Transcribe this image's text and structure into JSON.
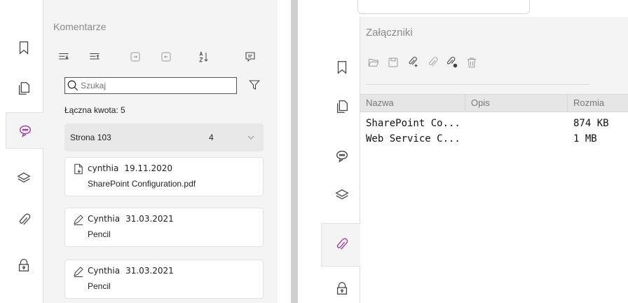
{
  "left_panel": {
    "title": "Komentarze",
    "search_placeholder": "Szukaj",
    "total_label": "Łączna kwota: 5",
    "group": {
      "label": "Strona 103",
      "count": "4"
    },
    "comments": [
      {
        "author": "cynthia",
        "date": "19.11.2020",
        "text": "SharePoint Configuration.pdf",
        "icon": "file-attachment-icon"
      },
      {
        "author": "Cynthia",
        "date": "31.03.2021",
        "text": "Pencil",
        "icon": "pencil-icon"
      },
      {
        "author": "Cynthia",
        "date": "31.03.2021",
        "text": "Pencil",
        "icon": "pencil-icon"
      }
    ]
  },
  "right_panel": {
    "title": "Załączniki",
    "columns": [
      "Nazwa",
      "Opis",
      "Rozmia"
    ],
    "rows": [
      {
        "name": "SharePoint Co...",
        "desc": "",
        "size": "874 KB"
      },
      {
        "name": "Web Service C...",
        "desc": "",
        "size": "1 MB"
      }
    ]
  },
  "colors": {
    "accent": "#a33aa0",
    "panel_bg": "#f4f4f4",
    "icon": "#444444"
  }
}
